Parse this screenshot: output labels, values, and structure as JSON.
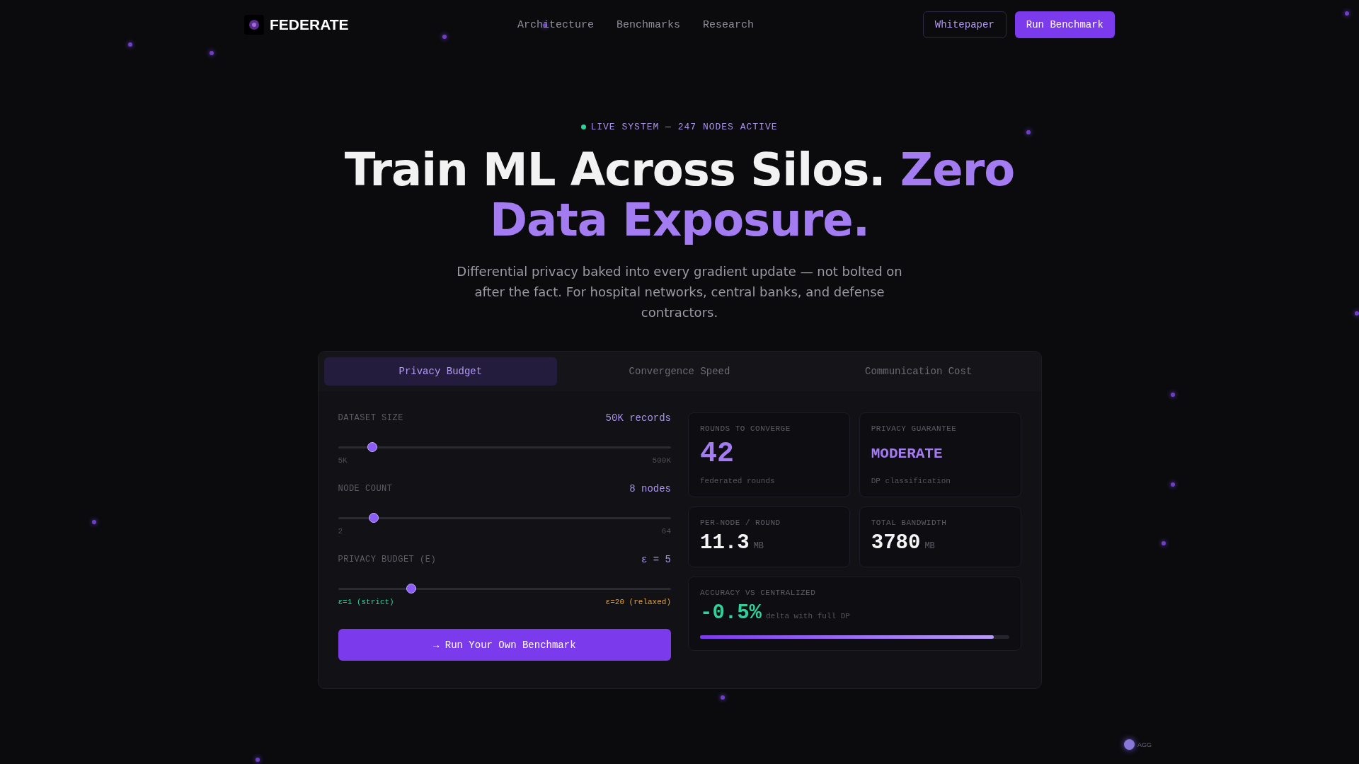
{
  "brand": {
    "name": "FEDERATE"
  },
  "nav": {
    "links": [
      "Architecture",
      "Benchmarks",
      "Research"
    ],
    "buttons": [
      {
        "label": "Whitepaper",
        "kind": "outline"
      },
      {
        "label": "Run Benchmark",
        "kind": "primary"
      }
    ]
  },
  "hero": {
    "badge": "LIVE SYSTEM — 247 NODES ACTIVE",
    "title": "Train ML Across Silos.",
    "title_accent": "Zero Data Exposure.",
    "subtitle": "Differential privacy baked into every gradient update — not bolted on after the fact. For hospital networks, central banks, and defense contractors."
  },
  "tabs": [
    {
      "label": "Privacy Budget",
      "selected": true
    },
    {
      "label": "Convergence Speed",
      "selected": false
    },
    {
      "label": "Communication Cost",
      "selected": false
    }
  ],
  "sliders": [
    {
      "label": "DATASET SIZE",
      "reading": "50K records",
      "level": 0.104,
      "min_label": "5K",
      "max_label": "500K",
      "kind": "scale"
    },
    {
      "label": "NODE COUNT",
      "reading": "8 nodes",
      "level": 0.108,
      "min_label": "2",
      "max_label": "64",
      "kind": "scale"
    },
    {
      "label": "PRIVACY BUDGET (E)",
      "reading": "ε = 5",
      "level": 0.22,
      "min_label": "ε=1 (strict)",
      "max_label": "ε=20 (relaxed)",
      "kind": "strict-relaxed"
    }
  ],
  "action_button": "→ Run Your Own Benchmark",
  "stats": [
    {
      "label": "ROUNDS TO CONVERGE",
      "value": "42",
      "caption": "federated rounds",
      "kind": "accent"
    },
    {
      "label": "PRIVACY GUARANTEE",
      "value": "MODERATE",
      "caption": "DP classification",
      "kind": "accent-word"
    },
    {
      "label": "PER-NODE / ROUND",
      "value": "11.3",
      "unit": "MB",
      "kind": "plain"
    },
    {
      "label": "TOTAL BANDWIDTH",
      "value": "3780",
      "unit": "MB",
      "kind": "plain"
    }
  ],
  "accuracy": {
    "label": "ACCURACY VS CENTRALIZED",
    "value": "-0.5%",
    "caption": "delta with full DP",
    "level": 0.95
  },
  "network": {
    "node_label": "AGG"
  }
}
